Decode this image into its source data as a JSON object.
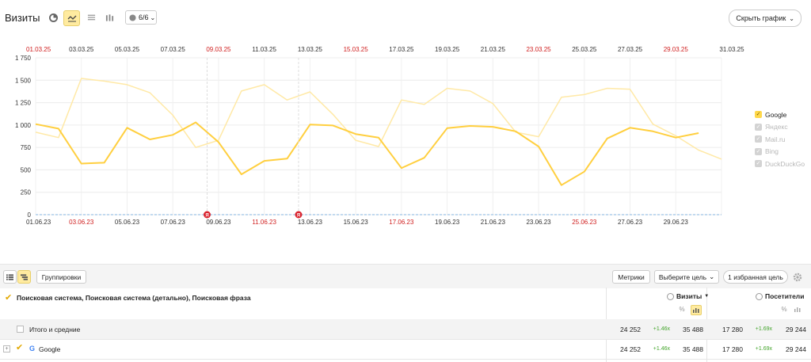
{
  "header": {
    "title": "Визиты",
    "segments_label": "6/6",
    "hide_chart_label": "Скрыть график"
  },
  "chart_data": {
    "type": "line",
    "x_top_ticks": [
      "01.03.25",
      "03.03.25",
      "05.03.25",
      "07.03.25",
      "09.03.25",
      "11.03.25",
      "13.03.25",
      "15.03.25",
      "17.03.25",
      "19.03.25",
      "21.03.25",
      "23.03.25",
      "25.03.25",
      "27.03.25",
      "29.03.25",
      "31.03.25"
    ],
    "x_top_red": [
      true,
      false,
      false,
      false,
      true,
      false,
      false,
      true,
      false,
      false,
      false,
      true,
      false,
      false,
      true,
      false
    ],
    "x_bottom_ticks": [
      "01.06.23",
      "03.06.23",
      "05.06.23",
      "07.06.23",
      "09.06.23",
      "11.06.23",
      "13.06.23",
      "15.06.23",
      "17.06.23",
      "19.06.23",
      "21.06.23",
      "23.06.23",
      "25.06.23",
      "27.06.23",
      "29.06.23"
    ],
    "x_bottom_red": [
      false,
      true,
      false,
      false,
      false,
      true,
      false,
      false,
      true,
      false,
      false,
      false,
      true,
      false,
      false
    ],
    "y_ticks": [
      "1 750",
      "1 500",
      "1 250",
      "1 000",
      "750",
      "500",
      "250",
      "0"
    ],
    "y_values": [
      1750,
      1500,
      1250,
      1000,
      750,
      500,
      250,
      0
    ],
    "ylim": [
      0,
      1750
    ],
    "series": [
      {
        "name": "Google",
        "role": "current",
        "color": "#ffcf3f",
        "values": [
          1010,
          960,
          570,
          580,
          970,
          840,
          890,
          1030,
          810,
          450,
          600,
          625,
          1005,
          995,
          900,
          860,
          520,
          635,
          965,
          990,
          980,
          930,
          760,
          330,
          480,
          850,
          970,
          930,
          860,
          910
        ]
      },
      {
        "name": "Google",
        "role": "comparison",
        "color": "#ffe9a6",
        "values": [
          920,
          860,
          1520,
          1490,
          1450,
          1360,
          1110,
          750,
          830,
          1380,
          1450,
          1280,
          1370,
          1120,
          830,
          760,
          1280,
          1230,
          1410,
          1380,
          1240,
          920,
          870,
          1310,
          1340,
          1410,
          1400,
          1010,
          880,
          720,
          620
        ]
      }
    ],
    "annotations": [
      {
        "label": "Я",
        "x_index": 7.5
      },
      {
        "label": "Я",
        "x_index": 11.5
      }
    ],
    "grid": true
  },
  "legend": [
    {
      "label": "Google",
      "active": true
    },
    {
      "label": "Яндекс",
      "active": false
    },
    {
      "label": "Mail.ru",
      "active": false
    },
    {
      "label": "Bing",
      "active": false
    },
    {
      "label": "DuckDuckGo",
      "active": false
    }
  ],
  "toolbar": {
    "groupings_label": "Группировки",
    "metrics_label": "Метрики",
    "goal_select_label": "Выберите цель",
    "favorite_goal_label": "1 избранная цель"
  },
  "table": {
    "dimension_header": "Поисковая система, Поисковая система (детально), Поисковая фраза",
    "visits_header": "Визиты",
    "visitors_header": "Посетители",
    "percent_symbol": "%",
    "sort_arrow": "▼",
    "total_row": {
      "label": "Итого и средние",
      "visits_prev": "24 252",
      "visits_delta": "+1.46x",
      "visits_curr": "35 488",
      "visitors_prev": "17 280",
      "visitors_delta": "+1.69x",
      "visitors_curr": "29 244"
    },
    "rows": [
      {
        "label": "Google",
        "visits_prev": "24 252",
        "visits_delta": "+1.46x",
        "visits_curr": "35 488",
        "visitors_prev": "17 280",
        "visitors_delta": "+1.69x",
        "visitors_curr": "29 244"
      }
    ]
  }
}
